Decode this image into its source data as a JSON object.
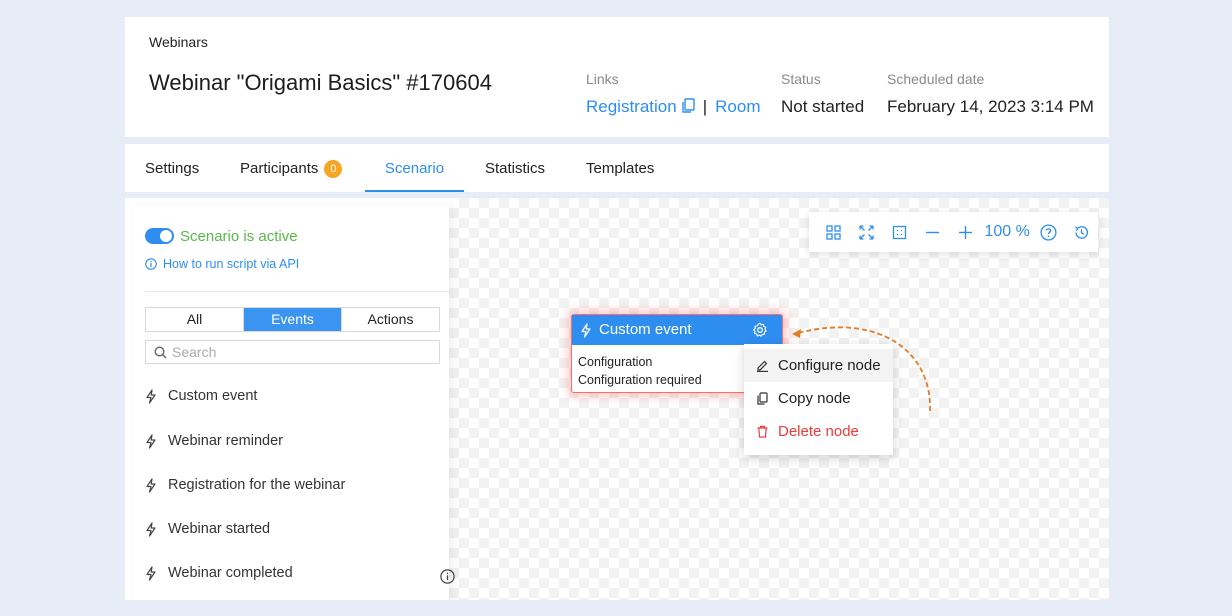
{
  "header": {
    "breadcrumb": "Webinars",
    "title": "Webinar \"Origami Basics\" #170604",
    "links_label": "Links",
    "link_registration": "Registration",
    "link_separator": "|",
    "link_room": "Room",
    "status_label": "Status",
    "status_value": "Not started",
    "date_label": "Scheduled date",
    "date_value": "February 14, 2023 3:14 PM"
  },
  "tabs": [
    {
      "label": "Settings"
    },
    {
      "label": "Participants",
      "badge": "0"
    },
    {
      "label": "Scenario",
      "active": true
    },
    {
      "label": "Statistics"
    },
    {
      "label": "Templates"
    }
  ],
  "left_panel": {
    "scenario_status": "Scenario is active",
    "api_link": "How to run script via API",
    "segments": [
      "All",
      "Events",
      "Actions"
    ],
    "active_segment": "Events",
    "search_placeholder": "Search",
    "events": [
      {
        "label": "Custom event"
      },
      {
        "label": "Webinar reminder"
      },
      {
        "label": "Registration for the webinar"
      },
      {
        "label": "Webinar started"
      },
      {
        "label": "Webinar completed"
      }
    ]
  },
  "toolbar": {
    "zoom": "100 %"
  },
  "node": {
    "title": "Custom event",
    "line1": "Configuration",
    "line2": "Configuration required"
  },
  "context_menu": {
    "items": [
      "Configure node",
      "Copy node",
      "Delete node"
    ]
  },
  "colors": {
    "accent": "#2e8ef0",
    "active_green": "#5ab84a",
    "badge": "#f5a623",
    "danger": "#f0393b",
    "arrow": "#e57b23"
  }
}
